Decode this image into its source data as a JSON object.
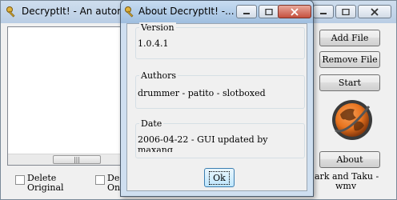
{
  "main_window": {
    "title": "DecryptIt! - An autom",
    "buttons": {
      "add_file": "Add File",
      "remove_file": "Remove File",
      "start": "Start",
      "about": "About"
    },
    "checkboxes": [
      {
        "label": "Delete Original",
        "checked": false
      },
      {
        "label": "De Onl",
        "checked": false
      }
    ],
    "credits_line1": "ark and Taku -",
    "credits_line2": "wmv",
    "scroll_thumb_grip": "|||"
  },
  "about_dialog": {
    "title": "About DecryptIt! -...",
    "version": {
      "heading": "Version",
      "value": "1.0.4.1"
    },
    "authors": {
      "heading": "Authors",
      "value": "drummer - patito - slotboxed"
    },
    "date": {
      "heading": "Date",
      "value": "2006-04-22 - GUI updated by",
      "value_line2": "maxang"
    },
    "ok_label": "Ok"
  },
  "colors": {
    "titlebar": "#b9cde4",
    "close_button": "#c5503f",
    "globe_orange": "#e8741f"
  }
}
